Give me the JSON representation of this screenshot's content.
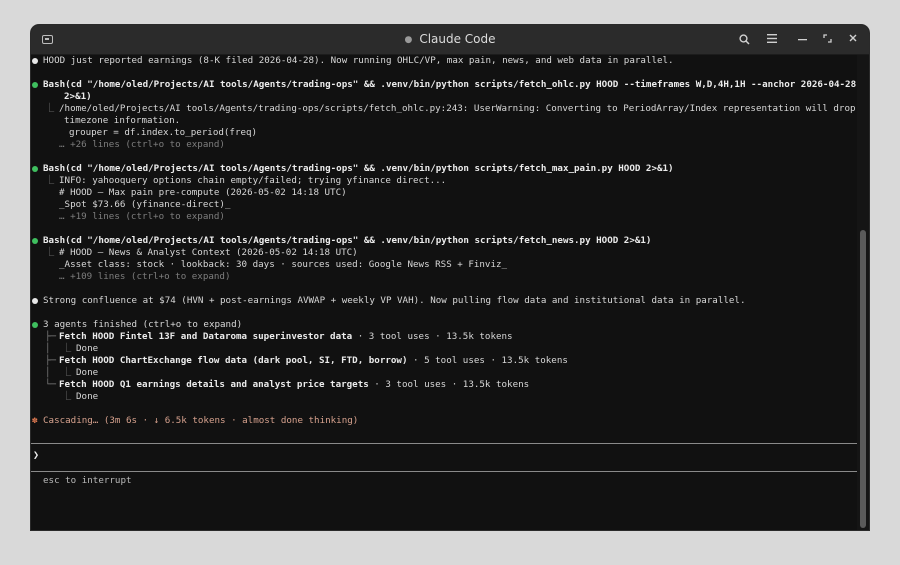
{
  "window": {
    "title": "Claude Code"
  },
  "titlebar_icons": [
    "terminal-icon",
    "search-icon",
    "menu-icon",
    "minimize-icon",
    "maximize-icon",
    "close-icon"
  ],
  "log": {
    "l1": "HOOD just reported earnings (8-K filed 2026-04-28). Now running OHLC/VP, max pain, news, and web data in parallel.",
    "b1_cmd": "Bash(cd \"/home/oled/Projects/AI tools/Agents/trading-ops\" && .venv/bin/python scripts/fetch_ohlc.py HOOD --timeframes W,D,4H,1H --anchor 2026-04-28",
    "b1_cmd2": "2>&1)",
    "b1_out1": "/home/oled/Projects/AI tools/Agents/trading-ops/scripts/fetch_ohlc.py:243: UserWarning: Converting to PeriodArray/Index representation will drop",
    "b1_out2": "timezone information.",
    "b1_out3": "grouper = df.index.to_period(freq)",
    "b1_more": "… +26 lines (ctrl+o to expand)",
    "b2_cmd": "Bash(cd \"/home/oled/Projects/AI tools/Agents/trading-ops\" && .venv/bin/python scripts/fetch_max_pain.py HOOD 2>&1)",
    "b2_out1": "INFO: yahooquery options chain empty/failed; trying yfinance direct...",
    "b2_out2": "# HOOD — Max pain pre-compute (2026-05-02 14:18 UTC)",
    "b2_out3": "_Spot $73.66 (yfinance-direct)_",
    "b2_more": "… +19 lines (ctrl+o to expand)",
    "b3_cmd": "Bash(cd \"/home/oled/Projects/AI tools/Agents/trading-ops\" && .venv/bin/python scripts/fetch_news.py HOOD 2>&1)",
    "b3_out1": "# HOOD — News & Analyst Context (2026-05-02 14:18 UTC)",
    "b3_out2": "_Asset class: stock · lookback: 30 days · sources used: Google News RSS + Finviz_",
    "b3_more": "… +109 lines (ctrl+o to expand)",
    "l2": "Strong confluence at $74 (HVN + post-earnings AVWAP + weekly VP VAH). Now pulling flow data and institutional data in parallel.",
    "agents_head": "3 agents finished (ctrl+o to expand)",
    "agents": [
      {
        "name": "Fetch HOOD Fintel 13F and Dataroma superinvestor data",
        "meta": " · 3 tool uses · 13.5k tokens",
        "status": "Done"
      },
      {
        "name": "Fetch HOOD ChartExchange flow data (dark pool, SI, FTD, borrow)",
        "meta": " · 5 tool uses · 13.5k tokens",
        "status": "Done"
      },
      {
        "name": "Fetch HOOD Q1 earnings details and analyst price targets",
        "meta": " · 3 tool uses · 13.5k tokens",
        "status": "Done"
      }
    ],
    "status": "Cascading… (3m 6s · ↓ 6.5k tokens · almost done thinking)"
  },
  "input": {
    "prompt": "❯",
    "hint": "esc to interrupt"
  },
  "colors": {
    "accent": "#e07a52",
    "bullet_green": "#3fbf5f",
    "background": "#111111"
  }
}
